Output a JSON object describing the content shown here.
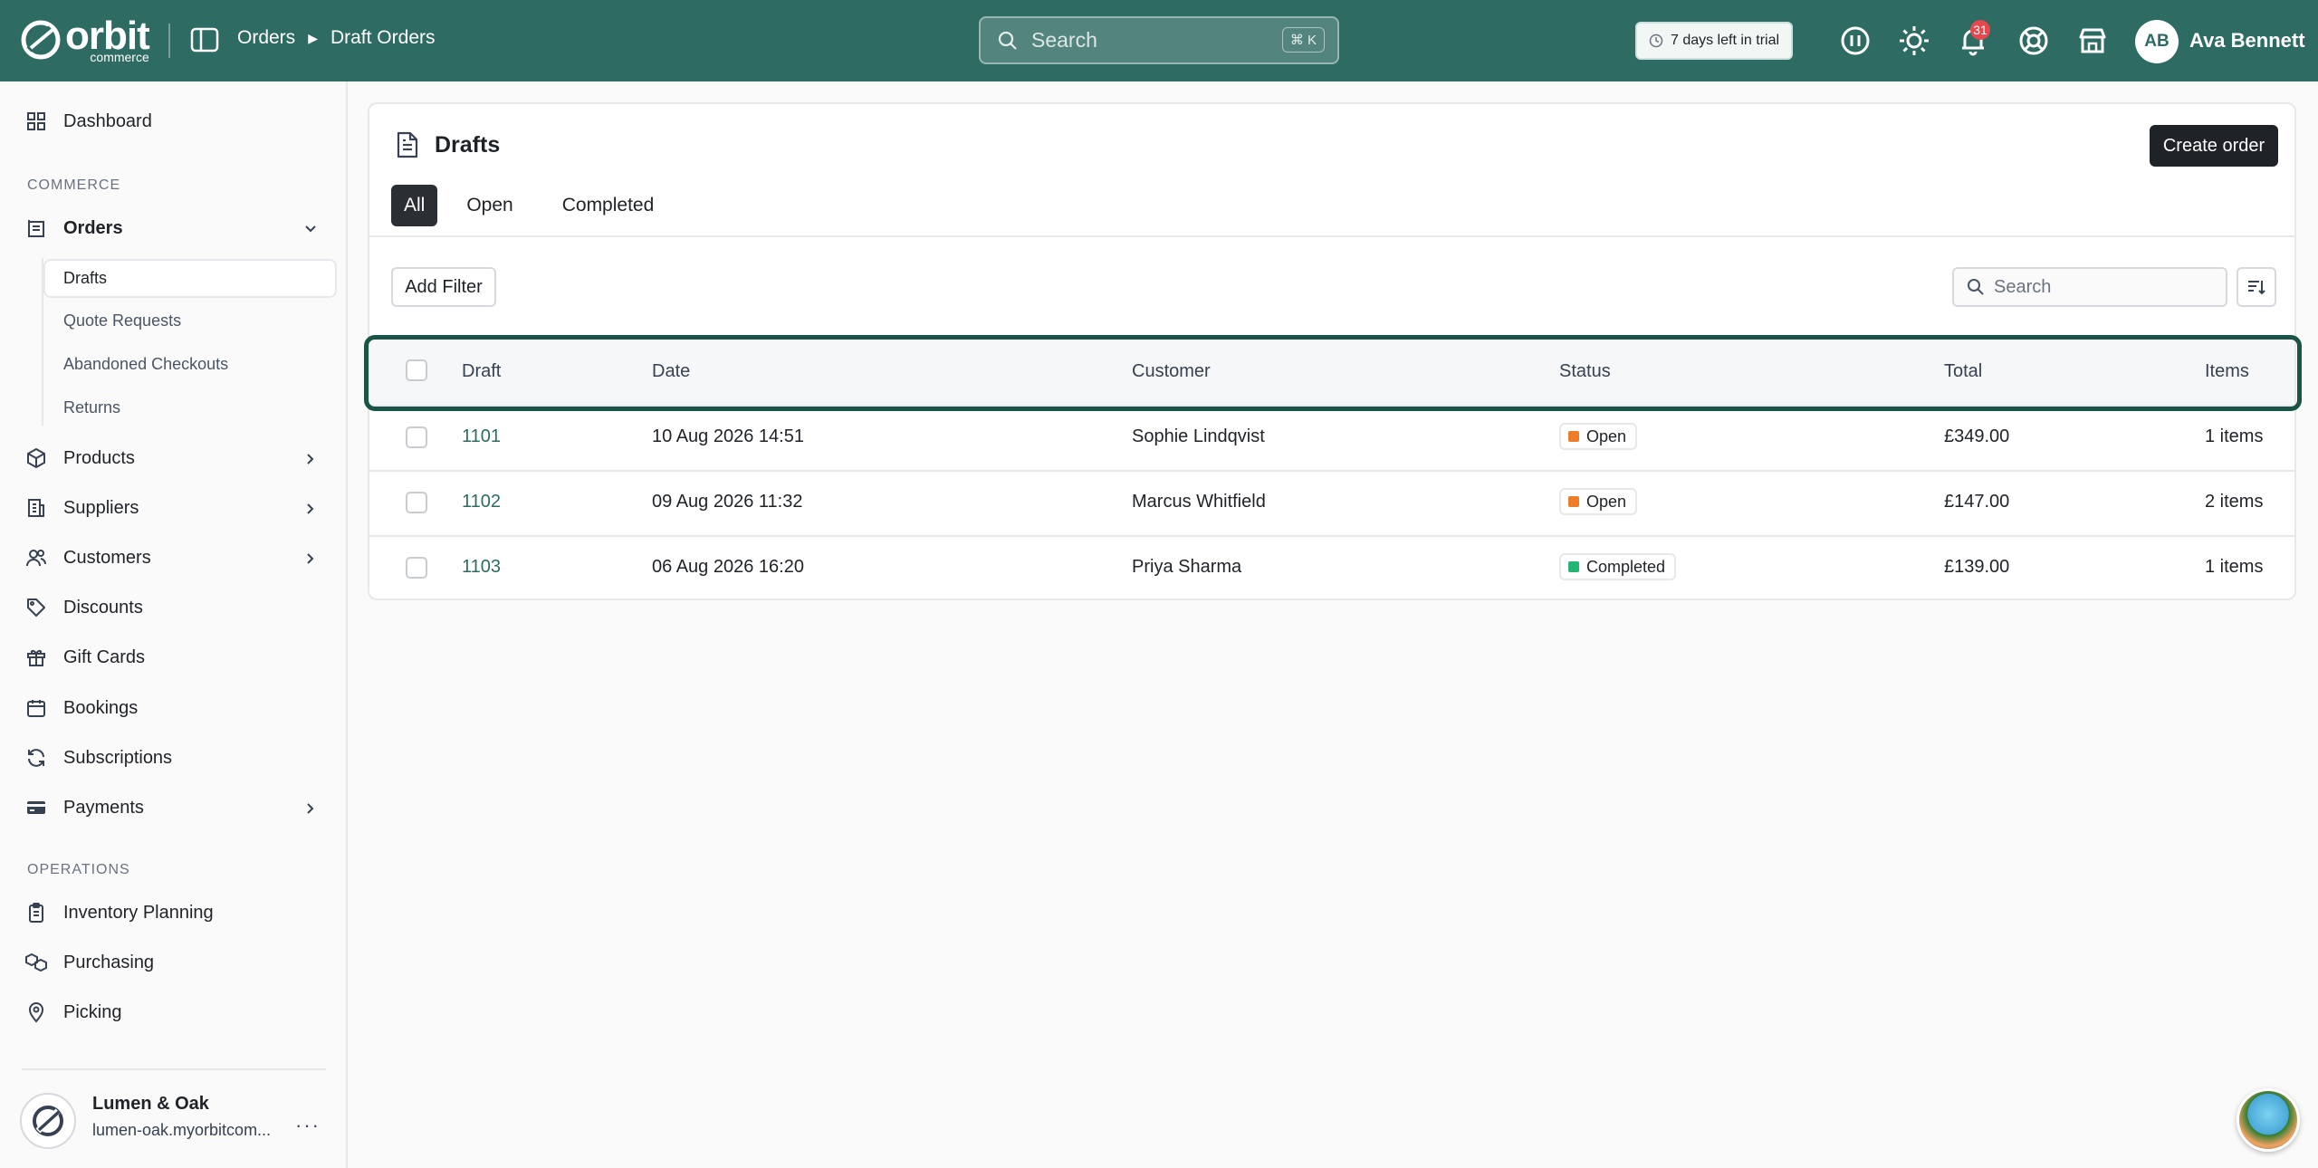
{
  "topbar": {
    "logo_word": "orbit",
    "logo_sub": "commerce",
    "breadcrumbs": [
      "Orders",
      "Draft Orders"
    ],
    "search_placeholder": "Search",
    "search_shortcut": "⌘ K",
    "trial_text": "7 days left in trial",
    "notification_count": "31",
    "user_initials": "AB",
    "user_name": "Ava Bennett"
  },
  "sidebar": {
    "dashboard": "Dashboard",
    "section_commerce": "COMMERCE",
    "orders": "Orders",
    "order_subitems": [
      "Drafts",
      "Quote Requests",
      "Abandoned Checkouts",
      "Returns"
    ],
    "products": "Products",
    "suppliers": "Suppliers",
    "customers": "Customers",
    "discounts": "Discounts",
    "gift_cards": "Gift Cards",
    "bookings": "Bookings",
    "subscriptions": "Subscriptions",
    "payments": "Payments",
    "section_operations": "OPERATIONS",
    "inventory_planning": "Inventory Planning",
    "purchasing": "Purchasing",
    "picking": "Picking",
    "store_name": "Lumen & Oak",
    "store_url": "lumen-oak.myorbitcom...",
    "more": "···"
  },
  "main": {
    "title": "Drafts",
    "create_button": "Create order",
    "tabs": [
      "All",
      "Open",
      "Completed"
    ],
    "add_filter": "Add Filter",
    "search_placeholder": "Search",
    "columns": [
      "Draft",
      "Date",
      "Customer",
      "Status",
      "Total",
      "Items"
    ],
    "rows": [
      {
        "draft": "1101",
        "date": "10 Aug 2026 14:51",
        "customer": "Sophie Lindqvist",
        "status": "Open",
        "total": "£349.00",
        "items": "1 items"
      },
      {
        "draft": "1102",
        "date": "09 Aug 2026 11:32",
        "customer": "Marcus Whitfield",
        "status": "Open",
        "total": "£147.00",
        "items": "2 items"
      },
      {
        "draft": "1103",
        "date": "06 Aug 2026 16:20",
        "customer": "Priya Sharma",
        "status": "Completed",
        "total": "£139.00",
        "items": "1 items"
      }
    ]
  },
  "colors": {
    "topbar": "#2e6b62",
    "open_status": "#f07c2a",
    "completed_status": "#22b573",
    "highlight": "#1a5447"
  }
}
